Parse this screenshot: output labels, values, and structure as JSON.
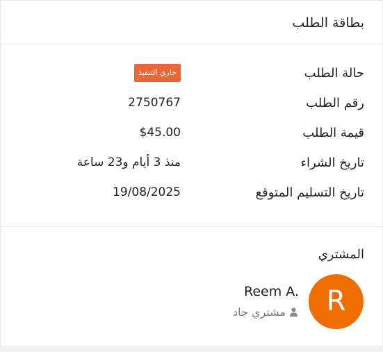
{
  "card": {
    "title": "بطاقة الطلب"
  },
  "order": {
    "status_label": "حالة الطلب",
    "status_value": "جاري التنفيذ",
    "number_label": "رقم الطلب",
    "number_value": "2750767",
    "amount_label": "قيمة الطلب",
    "amount_value": "$45.00",
    "purchase_date_label": "تاريخ الشراء",
    "purchase_date_value": "منذ 3 أيام و23 ساعة",
    "delivery_date_label": "تاريخ التسليم المتوقع",
    "delivery_date_value": "19/08/2025"
  },
  "buyer": {
    "heading": "المشتري",
    "avatar_letter": "R",
    "name": "Reem A.",
    "role": "مشتري جاد",
    "role_icon": "user-icon"
  },
  "colors": {
    "status_badge": "#ea6639",
    "avatar": "#ef6c00"
  }
}
